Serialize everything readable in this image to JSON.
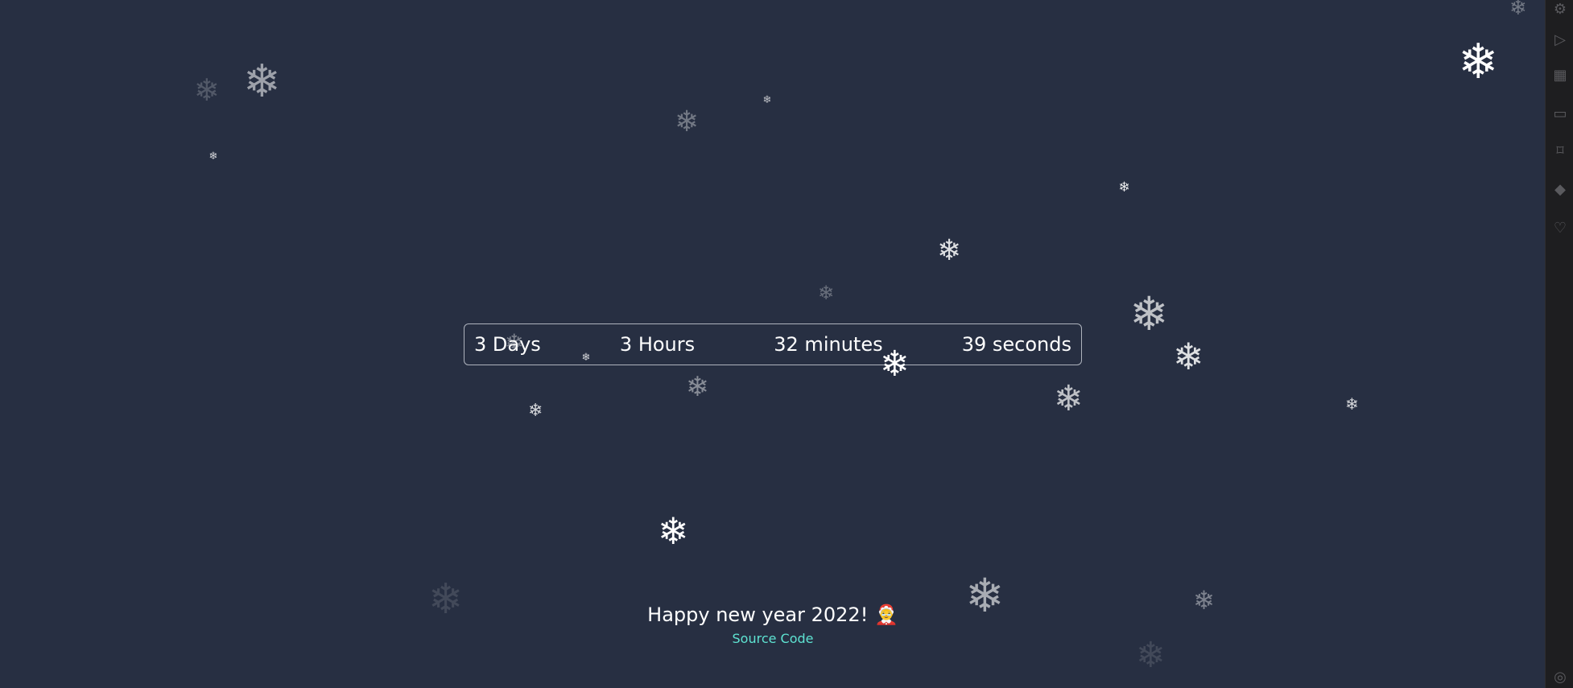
{
  "countdown": {
    "days": "3 Days",
    "hours": "3 Hours",
    "minutes": "32 minutes",
    "seconds": "39 seconds"
  },
  "footer": {
    "greeting": "Happy new year 2022! 🤶",
    "source_link": "Source Code"
  },
  "colors": {
    "background": "#272f42",
    "link": "#5ee3d2",
    "countdown_border": "#aeb3bd"
  },
  "icons": {
    "snowflake": "❄",
    "sidebar": [
      "settings-icon",
      "extensions-icon",
      "remote-icon",
      "bookmark-icon",
      "docker-icon",
      "heart-icon"
    ]
  }
}
